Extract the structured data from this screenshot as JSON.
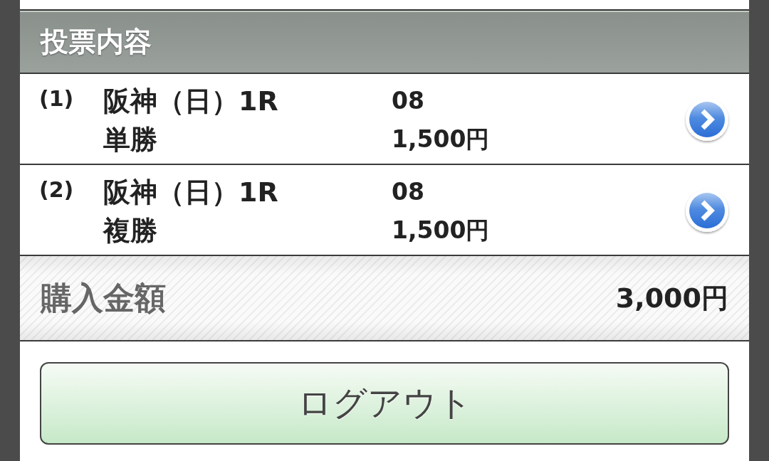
{
  "section_header": {
    "title": "投票内容"
  },
  "bets": [
    {
      "number": "(1)",
      "race": "阪神（日）1R",
      "bet_type": "単勝",
      "horse": "08",
      "amount": "1,500円"
    },
    {
      "number": "(2)",
      "race": "阪神（日）1R",
      "bet_type": "複勝",
      "horse": "08",
      "amount": "1,500円"
    }
  ],
  "total": {
    "label": "購入金額",
    "value": "3,000円"
  },
  "logout_button": {
    "label": "ログアウト"
  }
}
